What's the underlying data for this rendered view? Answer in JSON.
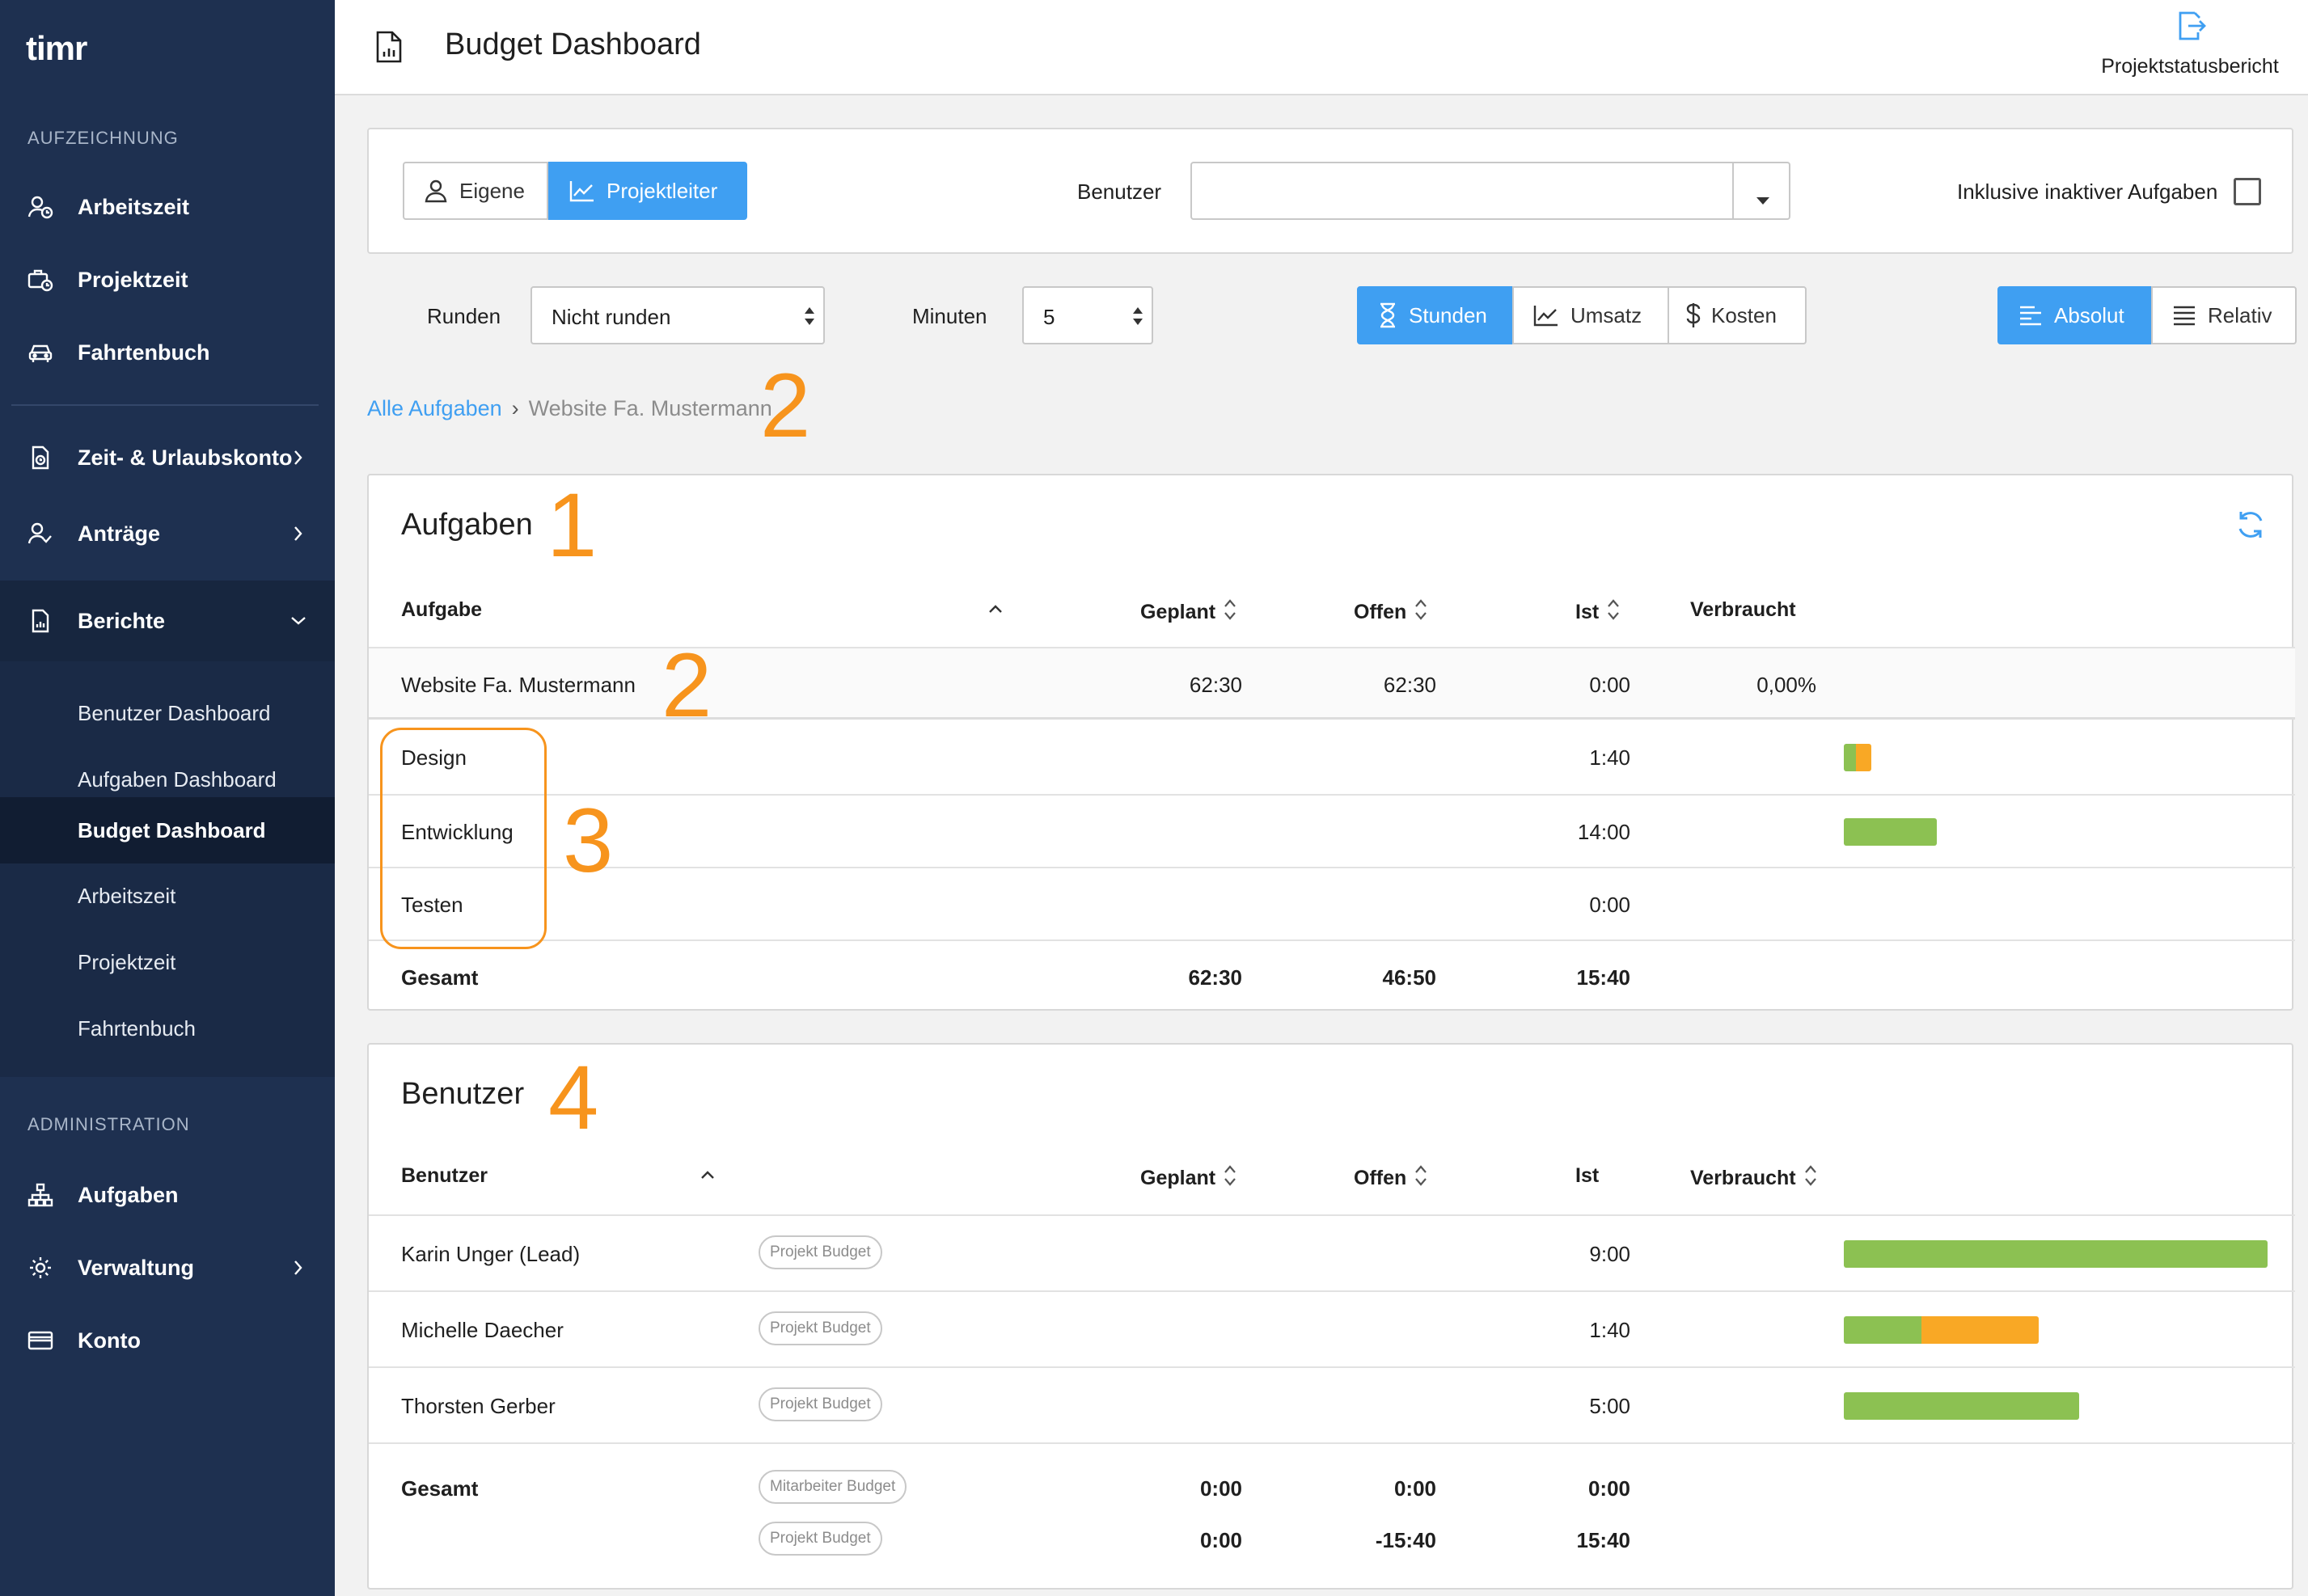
{
  "app": {
    "logo": "timr"
  },
  "sidebar": {
    "section_recording": "AUFZEICHNUNG",
    "recording_items": [
      {
        "label": "Arbeitszeit",
        "icon": "user-clock-icon"
      },
      {
        "label": "Projektzeit",
        "icon": "briefcase-clock-icon"
      },
      {
        "label": "Fahrtenbuch",
        "icon": "car-icon"
      }
    ],
    "account_items": [
      {
        "label": "Zeit- & Urlaubskonto",
        "icon": "document-clock-icon"
      },
      {
        "label": "Anträge",
        "icon": "user-check-icon"
      },
      {
        "label": "Berichte",
        "icon": "report-icon"
      }
    ],
    "reports_submenu": [
      {
        "label": "Benutzer Dashboard"
      },
      {
        "label": "Aufgaben Dashboard"
      },
      {
        "label": "Budget Dashboard",
        "active": true
      },
      {
        "label": "Arbeitszeit"
      },
      {
        "label": "Projektzeit"
      },
      {
        "label": "Fahrtenbuch"
      }
    ],
    "section_admin": "ADMINISTRATION",
    "admin_items": [
      {
        "label": "Aufgaben",
        "icon": "hierarchy-icon"
      },
      {
        "label": "Verwaltung",
        "icon": "gear-icon"
      },
      {
        "label": "Konto",
        "icon": "credit-card-icon"
      }
    ]
  },
  "header": {
    "title": "Budget Dashboard",
    "export_label": "Projektstatusbericht"
  },
  "filters": {
    "mode_own": "Eigene",
    "mode_pm": "Projektleiter",
    "user_label": "Benutzer",
    "user_value": "",
    "inactive_label": "Inklusive inaktiver Aufgaben",
    "inactive_checked": false,
    "rounding_label": "Runden",
    "rounding_value": "Nicht runden",
    "minutes_label": "Minuten",
    "minutes_value": "5",
    "metric_hours": "Stunden",
    "metric_revenue": "Umsatz",
    "metric_costs": "Kosten",
    "view_absolute": "Absolut",
    "view_relative": "Relativ"
  },
  "breadcrumb": {
    "root": "Alle Aufgaben",
    "sep": "›",
    "current": "Website Fa. Mustermann"
  },
  "annotations": {
    "a1": "1",
    "a2": "2",
    "a3": "3",
    "a4": "4"
  },
  "tasks_table": {
    "title": "Aufgaben",
    "headers": {
      "task": "Aufgabe",
      "planned": "Geplant",
      "open": "Offen",
      "actual": "Ist",
      "used": "Verbraucht"
    },
    "parent": {
      "name": "Website Fa. Mustermann",
      "planned": "62:30",
      "open": "62:30",
      "actual": "0:00",
      "used": "0,00%"
    },
    "rows": [
      {
        "name": "Design",
        "actual": "1:40",
        "bar_green": 0.45,
        "bar_orange": 0.55,
        "bar_scale": 0.065
      },
      {
        "name": "Entwicklung",
        "actual": "14:00",
        "bar_green": 1.0,
        "bar_orange": 0,
        "bar_scale": 0.22
      },
      {
        "name": "Testen",
        "actual": "0:00",
        "bar_green": 0,
        "bar_orange": 0,
        "bar_scale": 0
      }
    ],
    "total": {
      "label": "Gesamt",
      "planned": "62:30",
      "open": "46:50",
      "actual": "15:40"
    }
  },
  "users_table": {
    "title": "Benutzer",
    "headers": {
      "user": "Benutzer",
      "planned": "Geplant",
      "open": "Offen",
      "actual": "Ist",
      "used": "Verbraucht"
    },
    "rows": [
      {
        "name": "Karin Unger (Lead)",
        "badge": "Projekt Budget",
        "actual": "9:00",
        "bar_green": 1.0,
        "bar_orange": 0,
        "bar_scale": 1.0
      },
      {
        "name": "Michelle Daecher",
        "badge": "Projekt Budget",
        "actual": "1:40",
        "bar_green": 0.4,
        "bar_orange": 0.6,
        "bar_scale": 0.46
      },
      {
        "name": "Thorsten Gerber",
        "badge": "Projekt Budget",
        "actual": "5:00",
        "bar_green": 1.0,
        "bar_orange": 0,
        "bar_scale": 0.555
      }
    ],
    "total": {
      "label": "Gesamt",
      "employee_badge": "Mitarbeiter Budget",
      "employee": {
        "planned": "0:00",
        "open": "0:00",
        "actual": "0:00"
      },
      "project_badge": "Projekt Budget",
      "project": {
        "planned": "0:00",
        "open": "-15:40",
        "actual": "15:40"
      }
    }
  },
  "colors": {
    "sidebar": "#1e3050",
    "accent": "#3f9ff2",
    "bar_green": "#8cc152",
    "bar_orange": "#f9a825",
    "annotation": "#f7941d"
  }
}
